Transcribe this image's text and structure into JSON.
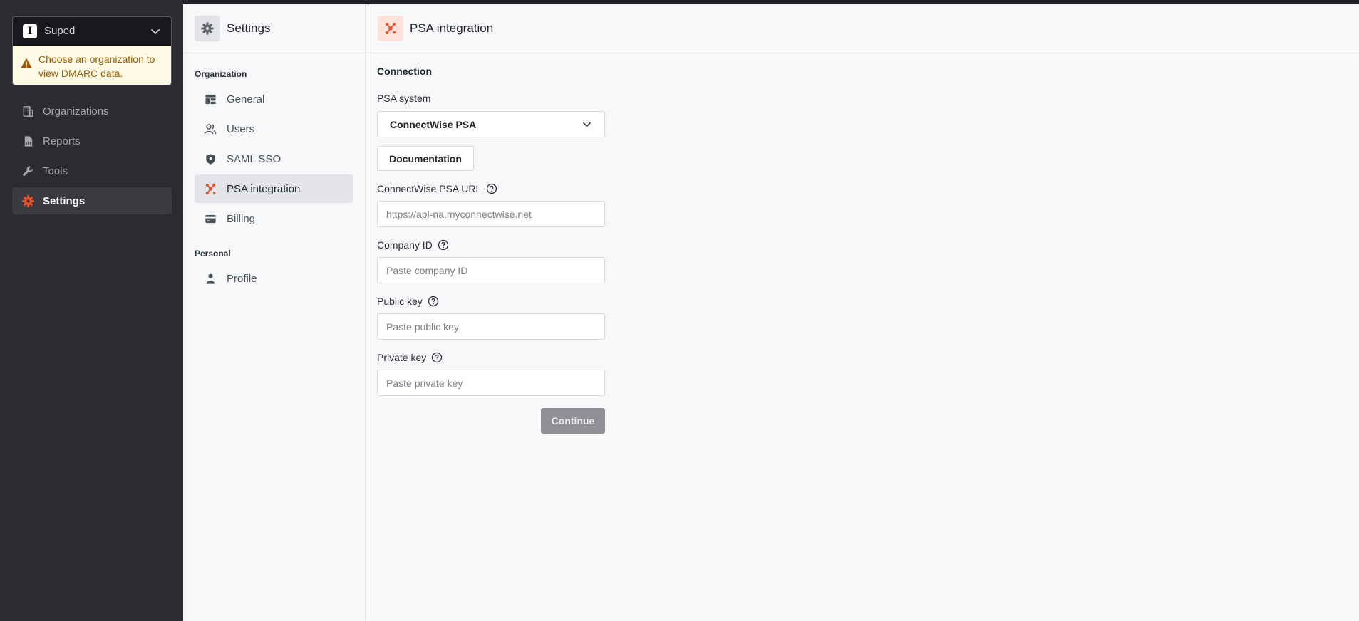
{
  "org": {
    "name": "Suped",
    "logo_letter": "I",
    "warning": "Choose an organization to view DMARC data."
  },
  "nav": {
    "items": [
      {
        "label": "Organizations",
        "icon": "building-icon",
        "active": false
      },
      {
        "label": "Reports",
        "icon": "report-icon",
        "active": false
      },
      {
        "label": "Tools",
        "icon": "wrench-icon",
        "active": false
      },
      {
        "label": "Settings",
        "icon": "gear-icon",
        "active": true
      }
    ]
  },
  "settings": {
    "title": "Settings",
    "organization_label": "Organization",
    "personal_label": "Personal",
    "items": [
      {
        "label": "General",
        "icon": "layout-icon"
      },
      {
        "label": "Users",
        "icon": "users-icon"
      },
      {
        "label": "SAML SSO",
        "icon": "shield-icon"
      },
      {
        "label": "PSA integration",
        "icon": "psa-icon",
        "active": true
      },
      {
        "label": "Billing",
        "icon": "credit-card-icon"
      }
    ],
    "personal_items": [
      {
        "label": "Profile",
        "icon": "person-icon"
      }
    ]
  },
  "main": {
    "title": "PSA integration",
    "section_title": "Connection",
    "psa_system_label": "PSA system",
    "psa_system_value": "ConnectWise PSA",
    "documentation_label": "Documentation",
    "fields": [
      {
        "label": "ConnectWise PSA URL",
        "placeholder": "https://api-na.myconnectwise.net",
        "value": ""
      },
      {
        "label": "Company ID",
        "placeholder": "Paste company ID",
        "value": ""
      },
      {
        "label": "Public key",
        "placeholder": "Paste public key",
        "value": ""
      },
      {
        "label": "Private key",
        "placeholder": "Paste private key",
        "value": ""
      }
    ],
    "continue_label": "Continue"
  },
  "colors": {
    "accent": "#e8502e",
    "sidebar_bg": "#2b2c31",
    "warning_bg": "#fffbe6",
    "warning_text": "#9a5b00",
    "disabled_button": "#8e9096"
  }
}
